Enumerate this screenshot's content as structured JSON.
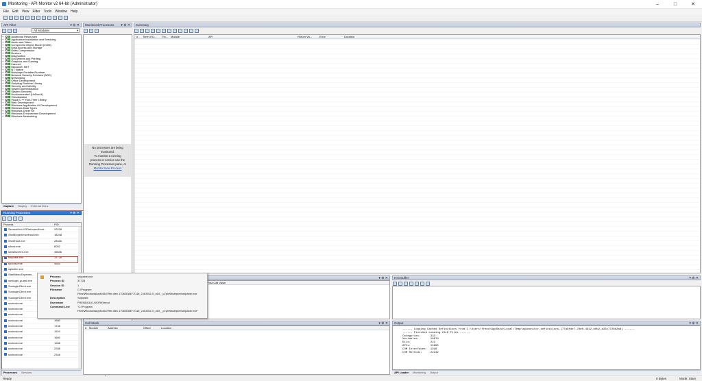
{
  "window": {
    "title": "Monitoring - API Monitor v2 64-bit (Administrator)"
  },
  "menu": [
    "File",
    "Edit",
    "View",
    "Filter",
    "Tools",
    "Window",
    "Help"
  ],
  "api_filter": {
    "title": "API Filter",
    "dropdown": "All Modules",
    "items": [
      "Additional Resources",
      "Application Installation and Servicing",
      "Audio and Video",
      "Component Object Model (COM)",
      "Data Access and Storage",
      "Delta Compression",
      "Devices",
      "Diagnostics",
      "Documents and Printing",
      "Graphics and Gaming",
      "Internet",
      "Microsoft .NET",
      "NT Native",
      "Netscape Portable Runtime",
      "Network Security Services (NSS)",
      "Networking",
      "Office Development",
      "Scripting Runtime Library",
      "Security and Identity",
      "System Administration",
      "System Services",
      "Undocumented (UnDoc'd)",
      "Virtualization",
      "Visual C++ Run-Time Library",
      "Web Development",
      "Windows Application UI Development",
      "Windows Data Types",
      "Windows Driver Kit",
      "Windows Environment Development",
      "Windows Networking"
    ],
    "tabs": [
      "Capture",
      "Display",
      "External DLLs"
    ]
  },
  "running": {
    "title": "Running Processes",
    "col_process": "Process",
    "col_pid": "PID",
    "rows": [
      {
        "name": "ServiceHub.VSDetouredHost...",
        "pid": "29228"
      },
      {
        "name": "ShellExperienceHost.exe",
        "pid": "18248"
      },
      {
        "name": "ShellHost.exe",
        "pid": "28416"
      },
      {
        "name": "sihost.exe",
        "pid": "6052"
      },
      {
        "name": "smartscreen.exe",
        "pid": "45636"
      },
      {
        "name": "snipaste.exe",
        "pid": "37728"
      },
      {
        "name": "spoolsv.exe",
        "pid": "4664"
      },
      {
        "name": "sqlwriter.exe",
        "pid": ""
      },
      {
        "name": "StartMenuExperien...",
        "pid": ""
      },
      {
        "name": "sunlogin_guard.exe",
        "pid": ""
      },
      {
        "name": "SunloginClient.exe",
        "pid": ""
      },
      {
        "name": "SunloginClient.exe",
        "pid": ""
      },
      {
        "name": "SunloginClient.exe",
        "pid": ""
      },
      {
        "name": "svchost.exe",
        "pid": ""
      },
      {
        "name": "svchost.exe",
        "pid": "1960"
      },
      {
        "name": "svchost.exe",
        "pid": ""
      },
      {
        "name": "svchost.exe",
        "pid": "1680"
      },
      {
        "name": "svchost.exe",
        "pid": "1748"
      },
      {
        "name": "svchost.exe",
        "pid": "1924"
      },
      {
        "name": "svchost.exe",
        "pid": "1660"
      },
      {
        "name": "svchost.exe",
        "pid": "1268"
      },
      {
        "name": "svchost.exe",
        "pid": "2288"
      },
      {
        "name": "svchost.exe",
        "pid": "2348"
      }
    ],
    "tabs": [
      "Processes",
      "Services"
    ]
  },
  "tooltip": {
    "rows": [
      {
        "k": "Process",
        "v": "snipaste.exe"
      },
      {
        "k": "Process ID",
        "v": "37728"
      },
      {
        "k": "Session ID",
        "v": "1"
      },
      {
        "k": "Filename",
        "v": "C:\\Program"
      },
      {
        "k": "",
        "v": "Files\\WindowsApps\\45479fe.dlex.17062D84F7C46_2.8.8011.0_x64__p7pnf6hceqser\\snipaste.exe"
      },
      {
        "k": "Description",
        "v": "Snipaste"
      },
      {
        "k": "Username",
        "v": "FRENDGUO-WORK\\frend"
      },
      {
        "k": "Command Line",
        "v": "\"C:\\Program"
      },
      {
        "k": "",
        "v": "Files\\WindowsApps\\45479fe.dlex.17062D84F7C46_2.8.8011.0_x64__p7pnf6hceqser\\snipaste.exe\""
      }
    ]
  },
  "monitored": {
    "title": "Monitored Processes",
    "empty": [
      "No processes are being",
      "monitored.",
      "To monitor a running",
      "process or service use the",
      "Running Processes pane, or"
    ],
    "link": "Monitor New Process"
  },
  "summary": {
    "title": "Summary",
    "cols": [
      "#",
      "Time of D...",
      "Thr...",
      "Module",
      "API",
      "Return Va...",
      "Error",
      "Duration"
    ]
  },
  "params": {
    "title": "Parameters",
    "col": "Post-Call Value"
  },
  "hexbuf": {
    "title": "Hex Buffer"
  },
  "callstack": {
    "title": "Call Stack",
    "cols": [
      "#",
      "Module",
      "Address",
      "Offset",
      "Location"
    ]
  },
  "output": {
    "title": "Output",
    "lines": [
      "------ Loading Cached Definitions from C:\\Users\\frend\\AppData\\Local\\Temp\\apimonitor-definitions-{77a8fde7-78e0-4912-b0b2-a33c7726b2a8} ------",
      "------ Finished Loading 2119 Files ------",
      "Categories:      333",
      "Variables:       19670",
      "DLLs:            222",
      "APIs:            15895",
      "COM Interfaces:  1926",
      "COM Methods:     22242"
    ],
    "tabs": [
      "API Loader",
      "Monitoring",
      "Output"
    ]
  },
  "status": {
    "left": "Ready",
    "bytes": "0 Bytes",
    "mode": "Mode: Starv"
  }
}
